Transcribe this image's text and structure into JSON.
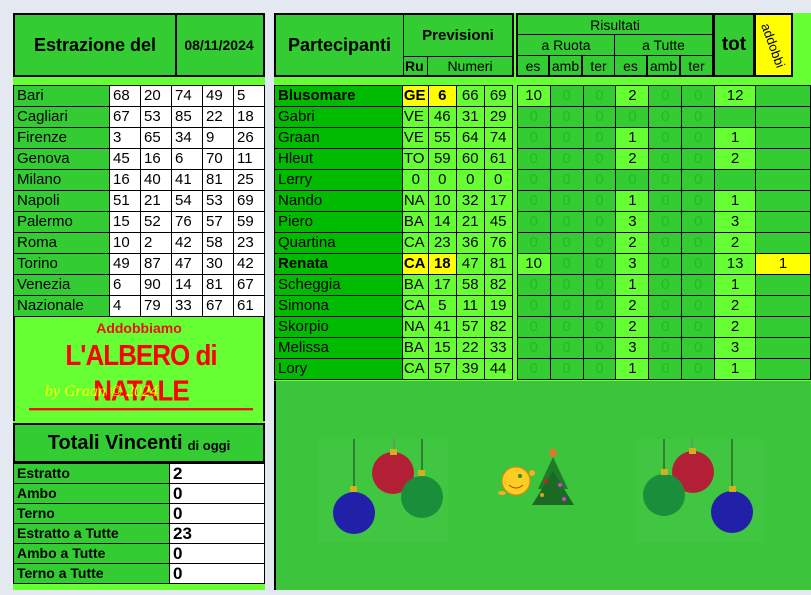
{
  "header": {
    "estrazione_label": "Estrazione del",
    "date": "08/11/2024"
  },
  "estrazioni": [
    {
      "ruota": "Bari",
      "numeri": [
        "68",
        "20",
        "74",
        "49",
        "5"
      ]
    },
    {
      "ruota": "Cagliari",
      "numeri": [
        "67",
        "53",
        "85",
        "22",
        "18"
      ]
    },
    {
      "ruota": "Firenze",
      "numeri": [
        "3",
        "65",
        "34",
        "9",
        "26"
      ]
    },
    {
      "ruota": "Genova",
      "numeri": [
        "45",
        "16",
        "6",
        "70",
        "11"
      ]
    },
    {
      "ruota": "Milano",
      "numeri": [
        "16",
        "40",
        "41",
        "81",
        "25"
      ]
    },
    {
      "ruota": "Napoli",
      "numeri": [
        "51",
        "21",
        "54",
        "53",
        "69"
      ]
    },
    {
      "ruota": "Palermo",
      "numeri": [
        "15",
        "52",
        "76",
        "57",
        "59"
      ]
    },
    {
      "ruota": "Roma",
      "numeri": [
        "10",
        "2",
        "42",
        "58",
        "23"
      ]
    },
    {
      "ruota": "Torino",
      "numeri": [
        "49",
        "87",
        "47",
        "30",
        "42"
      ]
    },
    {
      "ruota": "Venezia",
      "numeri": [
        "6",
        "90",
        "14",
        "81",
        "67"
      ]
    },
    {
      "ruota": "Nazionale",
      "numeri": [
        "4",
        "79",
        "33",
        "67",
        "61"
      ]
    }
  ],
  "banner": {
    "subtitle": "Addobbiamo",
    "title": "L'ALBERO di  NATALE",
    "credit": "by Graan © 2024"
  },
  "totali": {
    "title": "Totali Vincenti",
    "subtitle": "di oggi",
    "rows": [
      {
        "label": "Estratto",
        "value": "2"
      },
      {
        "label": "Ambo",
        "value": "0"
      },
      {
        "label": "Terno",
        "value": "0"
      },
      {
        "label": "Estratto a Tutte",
        "value": "23"
      },
      {
        "label": "Ambo a Tutte",
        "value": "0"
      },
      {
        "label": "Terno a Tutte",
        "value": "0"
      }
    ]
  },
  "columns": {
    "partecipanti": "Partecipanti",
    "previsioni": "Previsioni",
    "ru": "Ru",
    "numeri": "Numeri",
    "risultati": "Risultati",
    "a_ruota": "a Ruota",
    "a_tutte": "a Tutte",
    "es": "es",
    "amb": "amb",
    "ter": "ter",
    "tot": "tot",
    "addobbi": "addobbi"
  },
  "partecipanti": [
    {
      "name": "Blusomare",
      "ru": "GE",
      "n": [
        "6",
        "66",
        "69"
      ],
      "ruota": [
        "10",
        "0",
        "0"
      ],
      "tutte": [
        "2",
        "0",
        "0"
      ],
      "tot": "12",
      "addobbi": "",
      "style": "highlight"
    },
    {
      "name": "Gabri",
      "ru": "VE",
      "n": [
        "46",
        "31",
        "29"
      ],
      "ruota": [
        "0",
        "0",
        "0"
      ],
      "tutte": [
        "0",
        "0",
        "0"
      ],
      "tot": "",
      "addobbi": ""
    },
    {
      "name": "Graan",
      "ru": "VE",
      "n": [
        "55",
        "64",
        "74"
      ],
      "ruota": [
        "0",
        "0",
        "0"
      ],
      "tutte": [
        "1",
        "0",
        "0"
      ],
      "tot": "1",
      "addobbi": ""
    },
    {
      "name": "Hleut",
      "ru": "TO",
      "n": [
        "59",
        "60",
        "61"
      ],
      "ruota": [
        "0",
        "0",
        "0"
      ],
      "tutte": [
        "2",
        "0",
        "0"
      ],
      "tot": "2",
      "addobbi": ""
    },
    {
      "name": "Lerry",
      "ru": "0",
      "n": [
        "0",
        "0",
        "0"
      ],
      "ruota": [
        "0",
        "0",
        "0"
      ],
      "tutte": [
        "0",
        "0",
        "0"
      ],
      "tot": "",
      "addobbi": ""
    },
    {
      "name": "Nando",
      "ru": "NA",
      "n": [
        "10",
        "32",
        "17"
      ],
      "ruota": [
        "0",
        "0",
        "0"
      ],
      "tutte": [
        "1",
        "0",
        "0"
      ],
      "tot": "1",
      "addobbi": ""
    },
    {
      "name": "Piero",
      "ru": "BA",
      "n": [
        "14",
        "21",
        "45"
      ],
      "ruota": [
        "0",
        "0",
        "0"
      ],
      "tutte": [
        "3",
        "0",
        "0"
      ],
      "tot": "3",
      "addobbi": ""
    },
    {
      "name": "Quartina",
      "ru": "CA",
      "n": [
        "23",
        "36",
        "76"
      ],
      "ruota": [
        "0",
        "0",
        "0"
      ],
      "tutte": [
        "2",
        "0",
        "0"
      ],
      "tot": "2",
      "addobbi": ""
    },
    {
      "name": "Renata",
      "ru": "CA",
      "n": [
        "18",
        "47",
        "81"
      ],
      "ruota": [
        "10",
        "0",
        "0"
      ],
      "tutte": [
        "3",
        "0",
        "0"
      ],
      "tot": "13",
      "addobbi": "1",
      "style": "winner"
    },
    {
      "name": "Scheggia",
      "ru": "BA",
      "n": [
        "17",
        "58",
        "82"
      ],
      "ruota": [
        "0",
        "0",
        "0"
      ],
      "tutte": [
        "1",
        "0",
        "0"
      ],
      "tot": "1",
      "addobbi": ""
    },
    {
      "name": "Simona",
      "ru": "CA",
      "n": [
        "5",
        "11",
        "19"
      ],
      "ruota": [
        "0",
        "0",
        "0"
      ],
      "tutte": [
        "2",
        "0",
        "0"
      ],
      "tot": "2",
      "addobbi": ""
    },
    {
      "name": "Skorpio",
      "ru": "NA",
      "n": [
        "41",
        "57",
        "82"
      ],
      "ruota": [
        "0",
        "0",
        "0"
      ],
      "tutte": [
        "2",
        "0",
        "0"
      ],
      "tot": "2",
      "addobbi": ""
    },
    {
      "name": "Melissa",
      "ru": "BA",
      "n": [
        "15",
        "22",
        "33"
      ],
      "ruota": [
        "0",
        "0",
        "0"
      ],
      "tutte": [
        "3",
        "0",
        "0"
      ],
      "tot": "3",
      "addobbi": ""
    },
    {
      "name": "Lory",
      "ru": "CA",
      "n": [
        "57",
        "39",
        "44"
      ],
      "ruota": [
        "0",
        "0",
        "0"
      ],
      "tutte": [
        "1",
        "0",
        "0"
      ],
      "tot": "1",
      "addobbi": ""
    }
  ],
  "decorations": [
    "ornaments-left",
    "smiley",
    "christmas-tree",
    "ornaments-right"
  ]
}
